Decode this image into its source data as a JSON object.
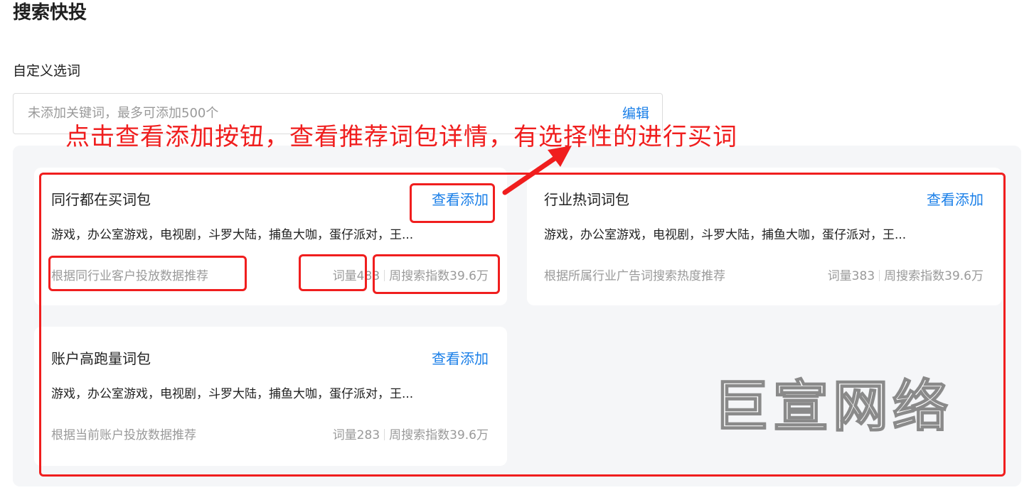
{
  "page": {
    "title": "搜索快投"
  },
  "custom_keywords": {
    "section_title": "自定义选词",
    "placeholder": "未添加关键词，最多可添加500个",
    "edit_label": "编辑"
  },
  "packages": [
    {
      "title": "同行都在买词包",
      "action_label": "查看添加",
      "words": "游戏，办公室游戏，电视剧，斗罗大陆，捕鱼大咖，蛋仔派对，王...",
      "description": "根据同行业客户投放数据推荐",
      "word_count": "词量483",
      "search_index": "周搜索指数39.6万"
    },
    {
      "title": "行业热词词包",
      "action_label": "查看添加",
      "words": "游戏，办公室游戏，电视剧，斗罗大陆，捕鱼大咖，蛋仔派对，王...",
      "description": "根据所属行业广告词搜索热度推荐",
      "word_count": "词量383",
      "search_index": "周搜索指数39.6万"
    },
    {
      "title": "账户高跑量词包",
      "action_label": "查看添加",
      "words": "游戏，办公室游戏，电视剧，斗罗大陆，捕鱼大咖，蛋仔派对，王...",
      "description": "根据当前账户投放数据推荐",
      "word_count": "词量283",
      "search_index": "周搜索指数39.6万"
    }
  ],
  "annotation": {
    "text": "点击查看添加按钮，查看推荐词包详情，有选择性的进行买词"
  },
  "watermark": {
    "text": "巨宣网络"
  },
  "colors": {
    "accent": "#1a7fe8",
    "annotation_red": "#f01e1e",
    "panel_bg": "#f5f6f8"
  }
}
